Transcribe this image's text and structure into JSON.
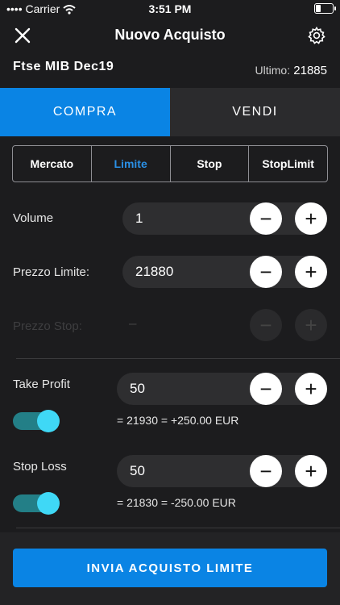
{
  "status_bar": {
    "carrier": "Carrier",
    "time": "3:51 PM"
  },
  "header": {
    "title": "Nuovo Acquisto",
    "close_icon": "close-icon",
    "settings_icon": "gear-icon"
  },
  "instrument": {
    "name": "Ftse MIB Dec19",
    "last_label": "Ultimo:",
    "last_value": "21885"
  },
  "tabs": {
    "buy": "COMPRA",
    "sell": "VENDI",
    "active": "buy"
  },
  "order_types": {
    "items": [
      "Mercato",
      "Limite",
      "Stop",
      "StopLimit"
    ],
    "selected": "Limite"
  },
  "fields": {
    "volume": {
      "label": "Volume",
      "value": "1"
    },
    "limit_price": {
      "label": "Prezzo Limite:",
      "value": "21880"
    },
    "stop_price": {
      "label": "Prezzo Stop:",
      "value": "–",
      "disabled": true
    }
  },
  "take_profit": {
    "label": "Take Profit",
    "value": "50",
    "enabled": true,
    "calc": "= 21930 = +250.00 EUR"
  },
  "stop_loss": {
    "label": "Stop Loss",
    "value": "50",
    "enabled": true,
    "calc": "= 21830 = -250.00 EUR"
  },
  "submit": {
    "label": "INVIA ACQUISTO LIMITE"
  },
  "colors": {
    "accent": "#0a84e4",
    "toggle_knob": "#3fd8f6",
    "background": "#1c1c1e"
  }
}
